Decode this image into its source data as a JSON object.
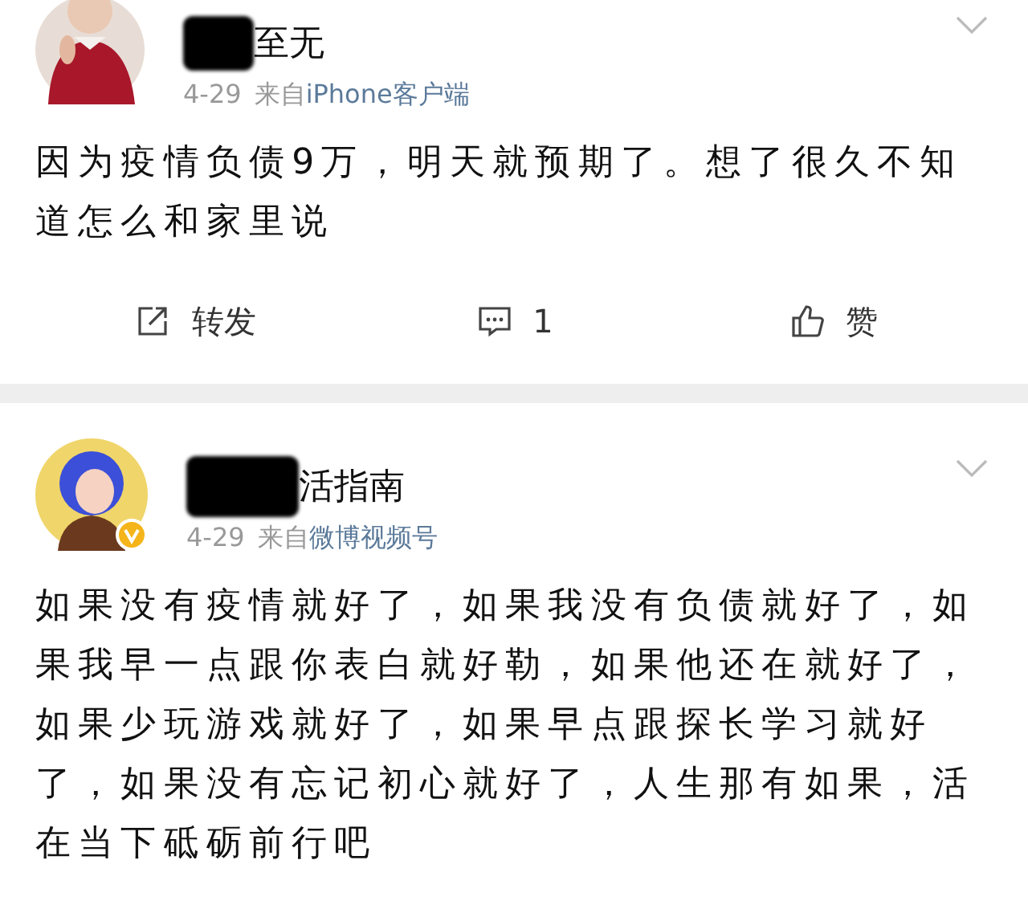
{
  "posts": [
    {
      "name": "至无",
      "date": "4-29",
      "source_prefix": "来自",
      "source": "iPhone客户端",
      "verified": false,
      "text": "因为疫情负债9万，明天就预期了。想了很久不知道怎么和家里说",
      "actions": [
        {
          "kind": "repost",
          "label": "转发"
        },
        {
          "kind": "comment",
          "label": "1"
        },
        {
          "kind": "like",
          "label": "赞"
        }
      ]
    },
    {
      "name": "活指南",
      "date": "4-29",
      "source_prefix": "来自",
      "source": "微博视频号",
      "verified": true,
      "text": "如果没有疫情就好了，如果我没有负债就好了，如果我早一点跟你表白就好勒，如果他还在就好了，如果少玩游戏就好了，如果早点跟探长学习就好了，如果没有忘记初心就好了，人生那有如果，活在当下砥砺前行吧"
    }
  ]
}
